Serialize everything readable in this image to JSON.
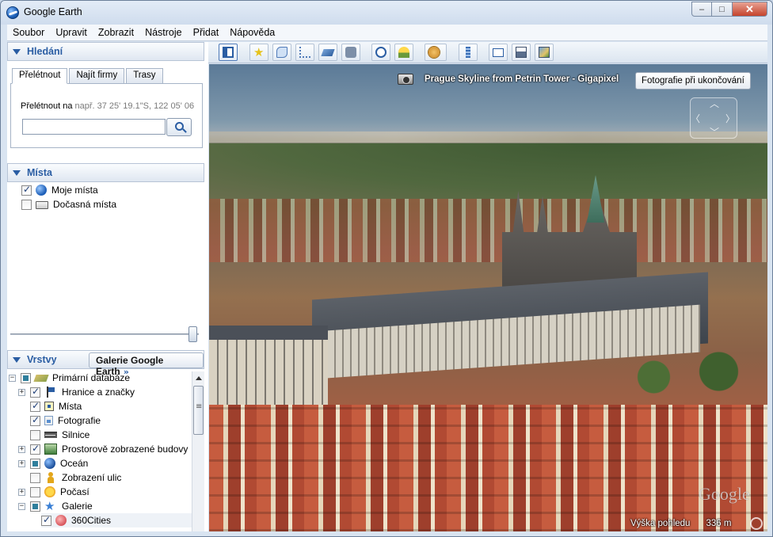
{
  "window": {
    "title": "Google Earth",
    "controls": {
      "minimize": "–",
      "maximize": "□",
      "close": "✕"
    }
  },
  "menu": [
    {
      "label": "Soubor"
    },
    {
      "label": "Upravit"
    },
    {
      "label": "Zobrazit"
    },
    {
      "label": "Nástroje"
    },
    {
      "label": "Přidat"
    },
    {
      "label": "Nápověda"
    }
  ],
  "search": {
    "title": "Hledání",
    "tabs": [
      "Přelétnout",
      "Najít firmy",
      "Trasy"
    ],
    "fly_label": "Přelétnout na",
    "fly_hint": "např. 37 25' 19.1\"S, 122 05' 06",
    "input_value": ""
  },
  "places": {
    "title": "Místa",
    "items": [
      {
        "label": "Moje místa",
        "checked": true,
        "icon": "globe-icon"
      },
      {
        "label": "Dočasná místa",
        "checked": false,
        "icon": "folder-icon"
      }
    ]
  },
  "layers": {
    "title": "Vrstvy",
    "gallery_button": "Galerie Google Earth",
    "gallery_chevron": "»",
    "items": [
      {
        "label": "Primární databáze",
        "state": "partial",
        "icon": "layers-icon",
        "expander": "−"
      },
      {
        "label": "Hranice a značky",
        "state": "checked",
        "icon": "flag-icon",
        "expander": "+"
      },
      {
        "label": "Místa",
        "state": "checked",
        "icon": "place-icon",
        "expander": ""
      },
      {
        "label": "Fotografie",
        "state": "checked",
        "icon": "photo-icon",
        "expander": ""
      },
      {
        "label": "Silnice",
        "state": "unchecked",
        "icon": "road-icon",
        "expander": ""
      },
      {
        "label": "Prostorově zobrazené budovy",
        "state": "checked",
        "icon": "building-icon",
        "expander": "+"
      },
      {
        "label": "Oceán",
        "state": "partial",
        "icon": "ocean-icon",
        "expander": "+"
      },
      {
        "label": "Zobrazení ulic",
        "state": "unchecked",
        "icon": "person-icon",
        "expander": ""
      },
      {
        "label": "Počasí",
        "state": "unchecked",
        "icon": "weather-icon",
        "expander": "+"
      },
      {
        "label": "Galerie",
        "state": "partial",
        "icon": "star-icon",
        "expander": "−"
      },
      {
        "label": "360Cities",
        "state": "checked",
        "icon": "cities-icon",
        "expander": ""
      }
    ]
  },
  "toolbar": {
    "buttons": [
      "sidebar-toggle-icon",
      "placemark-icon",
      "polygon-icon",
      "path-icon",
      "image-overlay-icon",
      "record-tour-icon",
      "historical-imagery-icon",
      "sunlight-icon",
      "planets-icon",
      "ruler-icon",
      "email-icon",
      "print-icon",
      "save-image-icon"
    ]
  },
  "view": {
    "photo_title": "Prague Skyline from Petrin Tower - Gigapixel",
    "exit_photo_button": "Fotografie při ukončování",
    "nav_arrows": {
      "up": "︿",
      "down": "﹀",
      "left": "〈",
      "right": "〉"
    },
    "watermark": "Google",
    "eye_alt_label": "Výška pohledu",
    "eye_alt_value": "336 m"
  }
}
